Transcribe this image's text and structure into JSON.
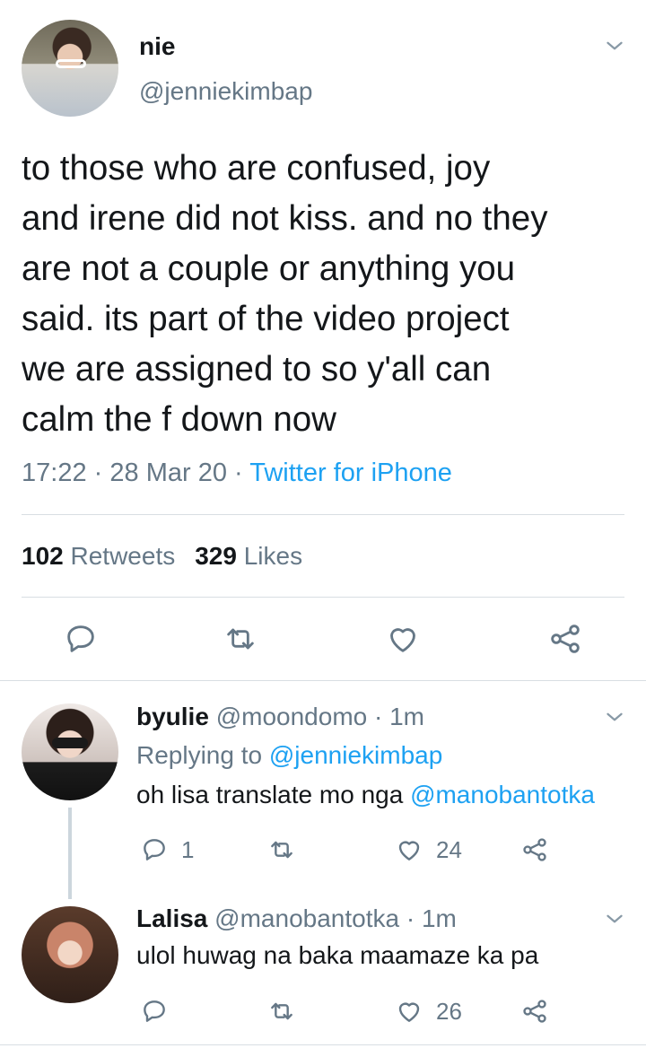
{
  "main_tweet": {
    "name": "nie",
    "handle": "@jenniekimbap",
    "text_lines": [
      "to those who are confused, joy",
      "and irene did not kiss. and no they",
      "are not a couple or anything you",
      "said. its part of the video project",
      "we are assigned to so y'all can",
      "calm the f down now"
    ],
    "time": "17:22",
    "date": "28 Mar 20",
    "separator": "·",
    "source": "Twitter for iPhone",
    "retweets_count": "102",
    "retweets_label": "Retweets",
    "likes_count": "329",
    "likes_label": "Likes",
    "actions": [
      "reply-icon",
      "retweet-icon",
      "like-icon",
      "share-icon"
    ]
  },
  "replies": [
    {
      "name": "byulie",
      "handle": "@moondomo",
      "time": "1m",
      "replying_to_label": "Replying to",
      "replying_to_handle": "@jenniekimbap",
      "text": "oh lisa translate mo nga",
      "mention": "@manobantotka",
      "reply_count": "1",
      "like_count": "24"
    },
    {
      "name": "Lalisa",
      "handle": "@manobantotka",
      "time": "1m",
      "text": "ulol huwag na baka maamaze ka pa",
      "like_count": "26"
    }
  ],
  "colors": {
    "text": "#14171a",
    "muted": "#657786",
    "link": "#1da1f2",
    "divider": "#d8dee3"
  }
}
